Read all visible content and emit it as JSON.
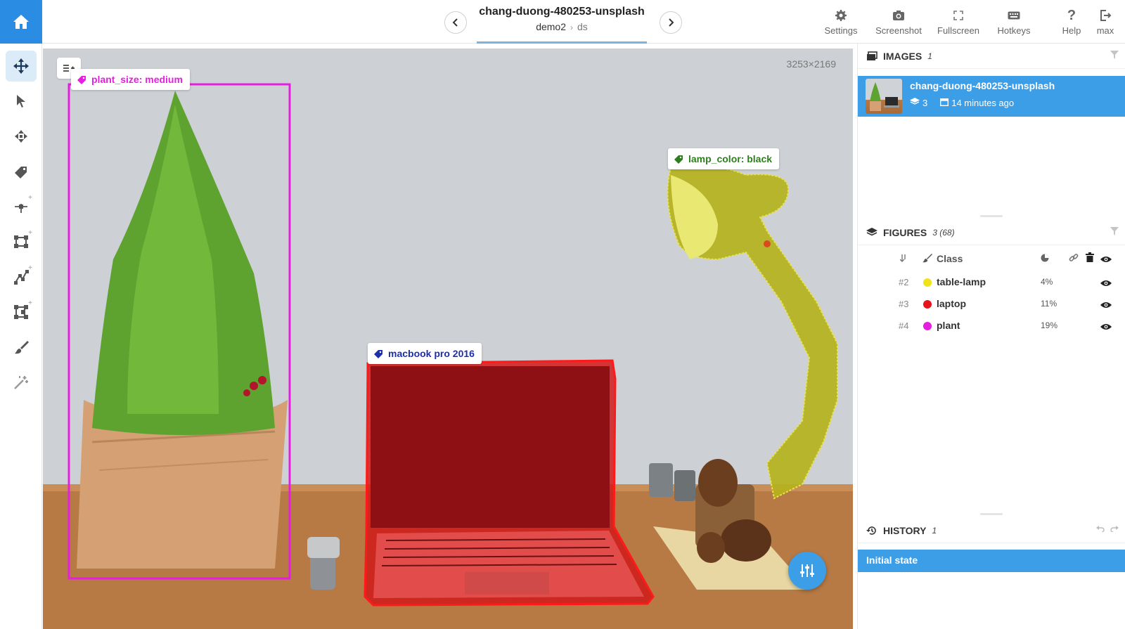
{
  "header": {
    "title": "chang-duong-480253-unsplash",
    "project": "demo2",
    "dataset": "ds",
    "tools": [
      {
        "id": "settings",
        "label": "Settings",
        "icon": "gear-icon"
      },
      {
        "id": "screenshot",
        "label": "Screenshot",
        "icon": "camera-icon"
      },
      {
        "id": "fullscreen",
        "label": "Fullscreen",
        "icon": "fullscreen-icon"
      },
      {
        "id": "hotkeys",
        "label": "Hotkeys",
        "icon": "keyboard-icon"
      },
      {
        "id": "help",
        "label": "Help",
        "icon": "question-icon"
      },
      {
        "id": "user",
        "label": "max",
        "icon": "logout-icon"
      }
    ]
  },
  "canvas": {
    "dimensions": "3253×2169",
    "annotations": [
      {
        "label": "plant_size: medium",
        "class": "plant",
        "color": "#e51ee0"
      },
      {
        "label": "lamp_color: black",
        "class": "table-lamp",
        "color": "#2e7d1e"
      },
      {
        "label": "macbook pro 2016",
        "class": "laptop",
        "color": "#1f2fa8"
      }
    ]
  },
  "images_panel": {
    "title": "IMAGES",
    "count": "1",
    "selected": {
      "name": "chang-duong-480253-unsplash",
      "figures": "3",
      "updated": "14 minutes ago"
    }
  },
  "figures_panel": {
    "title": "FIGURES",
    "count": "3 (68)",
    "class_header": "Class",
    "rows": [
      {
        "index": "#2",
        "class": "table-lamp",
        "color": "#f0e31a",
        "area": "4%"
      },
      {
        "index": "#3",
        "class": "laptop",
        "color": "#e8141c",
        "area": "11%"
      },
      {
        "index": "#4",
        "class": "plant",
        "color": "#e51ee0",
        "area": "19%"
      }
    ]
  },
  "history_panel": {
    "title": "HISTORY",
    "count": "1",
    "items": [
      "Initial state"
    ]
  }
}
